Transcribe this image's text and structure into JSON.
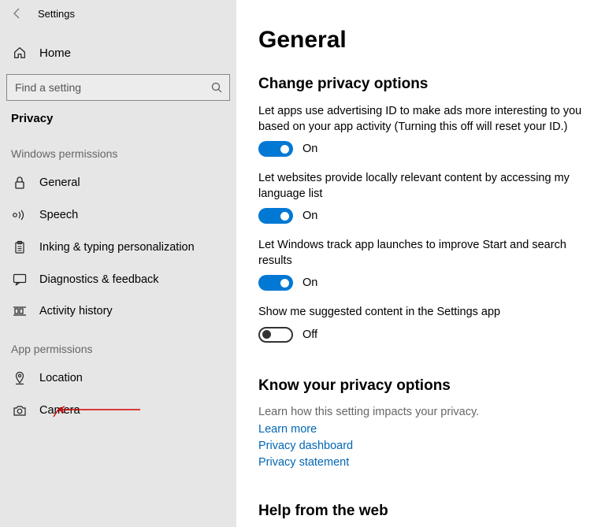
{
  "window": {
    "title": "Settings"
  },
  "sidebar": {
    "home": "Home",
    "search_placeholder": "Find a setting",
    "category": "Privacy",
    "section_windows": "Windows permissions",
    "section_app": "App permissions",
    "items_windows": [
      {
        "label": "General"
      },
      {
        "label": "Speech"
      },
      {
        "label": "Inking & typing personalization"
      },
      {
        "label": "Diagnostics & feedback"
      },
      {
        "label": "Activity history"
      }
    ],
    "items_app": [
      {
        "label": "Location"
      },
      {
        "label": "Camera"
      }
    ]
  },
  "page": {
    "title": "General",
    "section_change": "Change privacy options",
    "opts": [
      {
        "text": "Let apps use advertising ID to make ads more interesting to you based on your app activity (Turning this off will reset your ID.)",
        "state": "On",
        "on": true
      },
      {
        "text": "Let websites provide locally relevant content by accessing my language list",
        "state": "On",
        "on": true
      },
      {
        "text": "Let Windows track app launches to improve Start and search results",
        "state": "On",
        "on": true
      },
      {
        "text": "Show me suggested content in the Settings app",
        "state": "Off",
        "on": false
      }
    ],
    "section_know": "Know your privacy options",
    "know_desc": "Learn how this setting impacts your privacy.",
    "links": [
      "Learn more",
      "Privacy dashboard",
      "Privacy statement"
    ],
    "section_help": "Help from the web"
  }
}
